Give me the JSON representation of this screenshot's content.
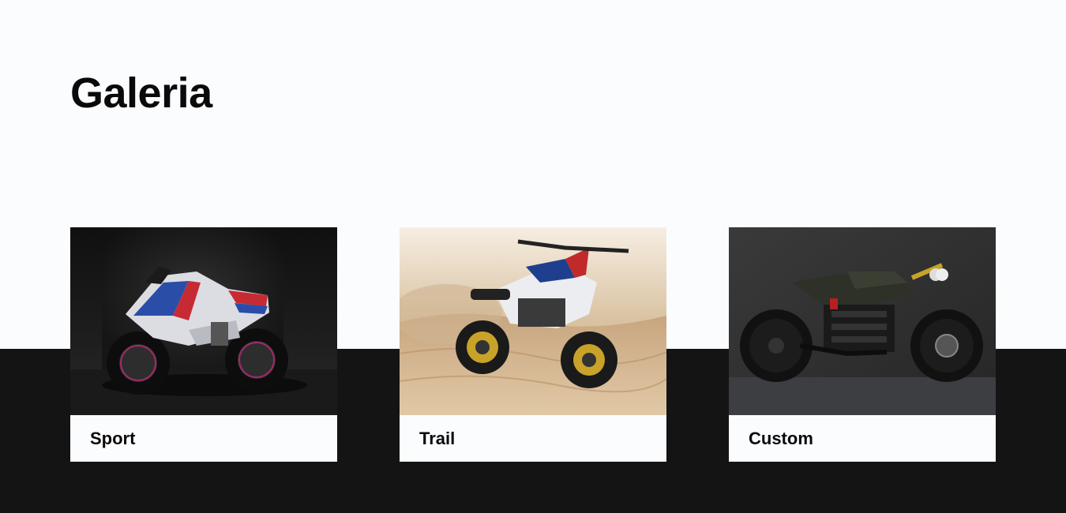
{
  "section": {
    "title": "Galeria"
  },
  "gallery": [
    {
      "label": "Sport",
      "icon": "sport-motorcycle-photo"
    },
    {
      "label": "Trail",
      "icon": "trail-motorcycle-photo"
    },
    {
      "label": "Custom",
      "icon": "custom-motorcycle-photo"
    }
  ],
  "colors": {
    "page_background": "#fbfcfe",
    "band_background": "#141414",
    "text": "#0a0a0a"
  }
}
